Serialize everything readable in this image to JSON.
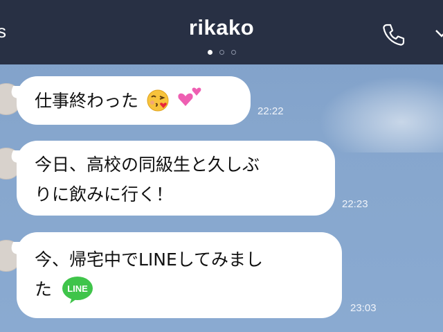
{
  "header": {
    "title": "rikako",
    "back_text": "s",
    "page_dots": 3,
    "active_dot": 0
  },
  "messages": [
    {
      "text": "仕事終わった",
      "emoji": [
        "kissing-face-heart",
        "two-hearts"
      ],
      "time": "22:22"
    },
    {
      "lines": [
        "今日、高校の同級生と久しぶ",
        "りに飲みに行く！"
      ],
      "time": "22:23"
    },
    {
      "lines": [
        "今、帰宅中でLINEしてみまし",
        "た"
      ],
      "sticker": "LINE",
      "time": "23:03"
    }
  ],
  "colors": {
    "header_bg": "#283044",
    "chat_bg": "#86a6cd",
    "bubble_bg": "#ffffff",
    "line_green": "#3fc44a"
  },
  "icons": [
    "phone-icon",
    "chevron-down-icon",
    "kissing-face-heart-emoji",
    "two-hearts-emoji",
    "line-logo"
  ]
}
